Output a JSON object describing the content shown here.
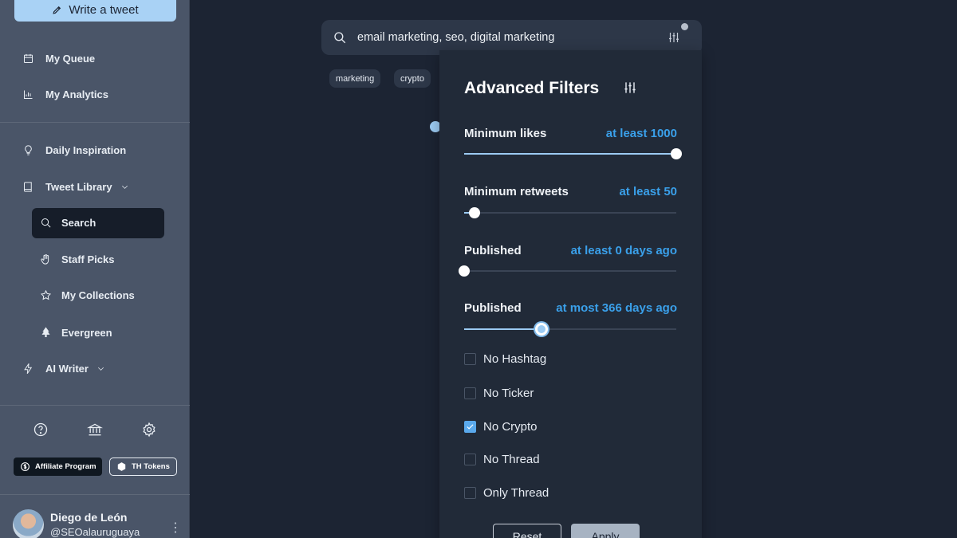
{
  "sidebar": {
    "write_button": "Write a tweet",
    "items": [
      {
        "label": "My Queue",
        "icon": "calendar-icon"
      },
      {
        "label": "My Analytics",
        "icon": "bar-chart-icon"
      },
      {
        "label": "Daily Inspiration",
        "icon": "lightbulb-icon"
      },
      {
        "label": "Tweet Library",
        "icon": "book-icon"
      },
      {
        "label": "Search",
        "icon": "search-icon"
      },
      {
        "label": "Staff Picks",
        "icon": "hand-icon"
      },
      {
        "label": "My Collections",
        "icon": "star-icon"
      },
      {
        "label": "Evergreen",
        "icon": "tree-icon"
      },
      {
        "label": "AI Writer",
        "icon": "lightning-icon"
      }
    ],
    "active_item": "Search",
    "affiliate_label": "Affiliate Program",
    "tokens_label": "TH Tokens",
    "user": {
      "name": "Diego de León",
      "handle": "@SEOalauruguaya"
    }
  },
  "search": {
    "value": "email marketing, seo, digital marketing"
  },
  "chips": [
    "marketing",
    "crypto"
  ],
  "filters": {
    "title": "Advanced Filters",
    "sliders": [
      {
        "label": "Minimum likes",
        "value_text": "at least 1000",
        "fraction": 1.0
      },
      {
        "label": "Minimum retweets",
        "value_text": "at least 50",
        "fraction": 0.05
      },
      {
        "label": "Published",
        "value_text": "at least 0 days ago",
        "fraction": 0.0
      },
      {
        "label": "Published",
        "value_text": "at most 366 days ago",
        "fraction": 0.365
      }
    ],
    "checkboxes": [
      {
        "label": "No Hashtag",
        "checked": false
      },
      {
        "label": "No Ticker",
        "checked": false
      },
      {
        "label": "No Crypto",
        "checked": true
      },
      {
        "label": "No Thread",
        "checked": false
      },
      {
        "label": "Only Thread",
        "checked": false
      }
    ],
    "reset_label": "Reset",
    "apply_label": "Apply"
  },
  "colors": {
    "accent": "#3aa0ea",
    "background": "#1c2433",
    "sidebar": "#4a5568",
    "panel": "#212a38"
  }
}
